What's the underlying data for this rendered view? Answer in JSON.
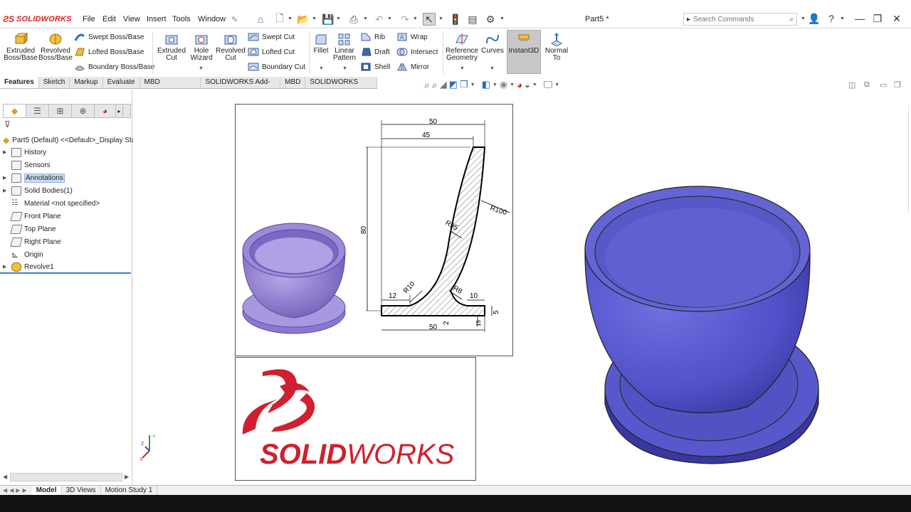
{
  "app": {
    "brand": "SOLIDWORKS",
    "doc_title": "Part5 *"
  },
  "menu": [
    "File",
    "Edit",
    "View",
    "Insert",
    "Tools",
    "Window"
  ],
  "search": {
    "placeholder": "Search Commands"
  },
  "ribbon": {
    "extruded_boss": "Extruded Boss/Base",
    "revolved_boss": "Revolved Boss/Base",
    "swept_boss": "Swept Boss/Base",
    "lofted_boss": "Lofted Boss/Base",
    "boundary_boss": "Boundary Boss/Base",
    "extruded_cut": "Extruded Cut",
    "hole_wizard": "Hole Wizard",
    "revolved_cut": "Revolved Cut",
    "swept_cut": "Swept Cut",
    "lofted_cut": "Lofted Cut",
    "boundary_cut": "Boundary Cut",
    "fillet": "Fillet",
    "linear_pattern": "Linear Pattern",
    "rib": "Rib",
    "draft": "Draft",
    "shell": "Shell",
    "wrap": "Wrap",
    "intersect": "Intersect",
    "mirror": "Mirror",
    "reference_geometry": "Reference Geometry",
    "curves": "Curves",
    "instant3d": "Instant3D",
    "normal_to": "Normal To"
  },
  "tabs": [
    "Features",
    "Sketch",
    "Markup",
    "Evaluate",
    "MBD Dimensions",
    "SOLIDWORKS Add-Ins",
    "MBD",
    "SOLIDWORKS CAM"
  ],
  "tree": {
    "root": "Part5 (Default) <<Default>_Display Sta",
    "items": [
      "History",
      "Sensors",
      "Annotations",
      "Solid Bodies(1)",
      "Material <not specified>",
      "Front Plane",
      "Top Plane",
      "Right Plane",
      "Origin",
      "Revolve1"
    ]
  },
  "bottom_tabs": [
    "Model",
    "3D Views",
    "Motion Study 1"
  ],
  "drawing": {
    "dims": [
      "50",
      "45",
      "80",
      "R100",
      "R95",
      "R10",
      "R8",
      "12",
      "10",
      "5",
      "50",
      "2",
      "15"
    ]
  },
  "logo_text": {
    "solid": "SOLID",
    "works": "WORKS"
  },
  "colors": {
    "model": "#5a5ad0",
    "model_dark": "#3c3ca8",
    "accent": "#d0202f"
  }
}
